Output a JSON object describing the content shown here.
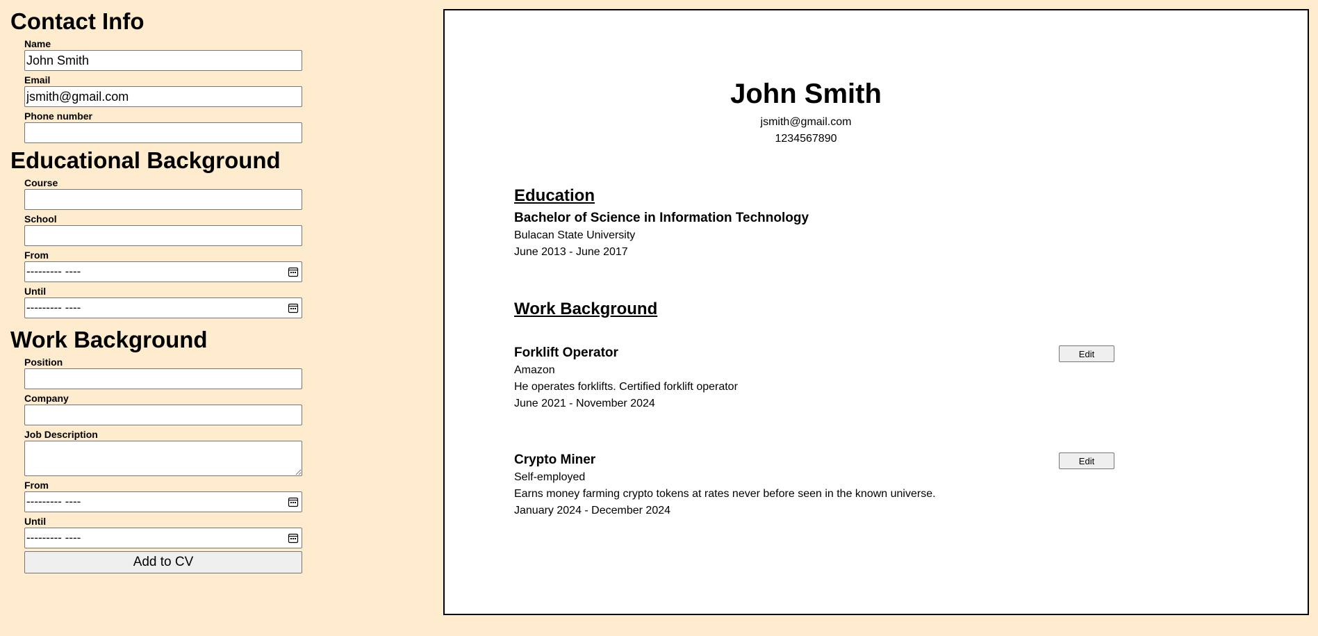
{
  "contact_info": {
    "heading": "Contact Info",
    "name_label": "Name",
    "name_value": "John Smith",
    "email_label": "Email",
    "email_value": "jsmith@gmail.com",
    "phone_label": "Phone number",
    "phone_value": ""
  },
  "education_form": {
    "heading": "Educational Background",
    "course_label": "Course",
    "school_label": "School",
    "from_label": "From",
    "until_label": "Until",
    "date_placeholder": "--------- ----"
  },
  "work_form": {
    "heading": "Work Background",
    "position_label": "Position",
    "company_label": "Company",
    "description_label": "Job Description",
    "from_label": "From",
    "until_label": "Until",
    "date_placeholder": "--------- ----",
    "add_button": "Add to CV"
  },
  "cv": {
    "name": "John Smith",
    "email": "jsmith@gmail.com",
    "phone": "1234567890",
    "education_heading": "Education",
    "education": {
      "course": "Bachelor of Science in Information Technology",
      "school": "Bulacan State University",
      "dates": "June 2013 - June 2017"
    },
    "work_heading": "Work Background",
    "edit_label": "Edit",
    "jobs": [
      {
        "position": "Forklift Operator",
        "company": "Amazon",
        "description": "He operates forklifts. Certified forklift operator",
        "dates": "June 2021 - November 2024"
      },
      {
        "position": "Crypto Miner",
        "company": "Self-employed",
        "description": "Earns money farming crypto tokens at rates never before seen in the known universe.",
        "dates": "January 2024 - December 2024"
      }
    ]
  }
}
